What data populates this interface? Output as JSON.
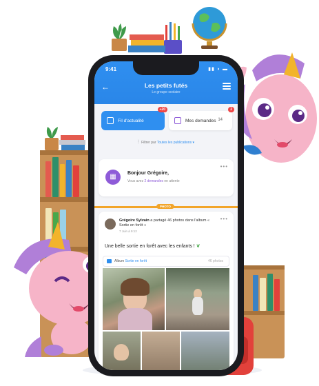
{
  "status": {
    "time": "9:41",
    "icons": "▮▮ ◗ ▬"
  },
  "header": {
    "title": "Les petits futés",
    "subtitle": "Le groupe scolaire"
  },
  "tabs": [
    {
      "label": "Fil d'actualité",
      "badge": "+20"
    },
    {
      "label": "Mes demandes",
      "badge": "2",
      "count": "14"
    }
  ],
  "filter": {
    "prefix": "Filtrer par",
    "link": "Toutes les publications"
  },
  "hello_card": {
    "title": "Bonjour Grégoire,",
    "sub_prefix": "Vous avez",
    "sub_link": "2 demandes",
    "sub_suffix": "en attente"
  },
  "divider_tag": "PHOTO",
  "post": {
    "author": "Grégoire Sylvain",
    "action": "a partagé 46 photos dans l'album « Sortie en forêt »",
    "date": "7 Juin à 9:12",
    "text": "Une belle sortie en forêt avec les enfants !",
    "album_prefix": "Album",
    "album_name": "Sortie en forêt",
    "album_count": "46 photos"
  },
  "colors": {
    "primary": "#2f8ff0",
    "accent": "#8e5bd8",
    "alert": "#ef4444",
    "divider": "#f2a52b"
  }
}
